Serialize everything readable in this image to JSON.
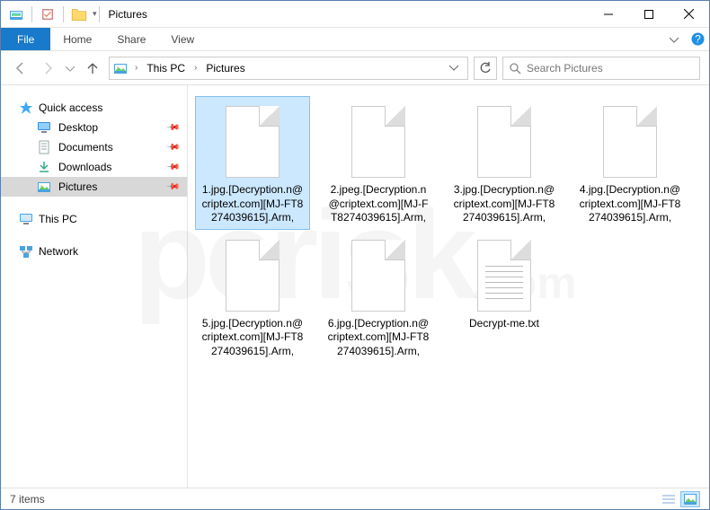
{
  "window": {
    "title": "Pictures"
  },
  "ribbon": {
    "file": "File",
    "tabs": [
      "Home",
      "Share",
      "View"
    ]
  },
  "breadcrumb": {
    "root": "This PC",
    "current": "Pictures"
  },
  "search": {
    "placeholder": "Search Pictures"
  },
  "sidebar": {
    "quick_access": "Quick access",
    "items": [
      {
        "label": "Desktop",
        "icon": "desktop"
      },
      {
        "label": "Documents",
        "icon": "documents"
      },
      {
        "label": "Downloads",
        "icon": "downloads"
      },
      {
        "label": "Pictures",
        "icon": "pictures",
        "selected": true
      }
    ],
    "this_pc": "This PC",
    "network": "Network"
  },
  "files": [
    {
      "name": "1.jpg.[Decryption.n@criptext.com][MJ-FT8274039615].Arm,",
      "type": "blank",
      "selected": true
    },
    {
      "name": "2.jpeg.[Decryption.n@criptext.com][MJ-FT8274039615].Arm,",
      "type": "blank"
    },
    {
      "name": "3.jpg.[Decryption.n@criptext.com][MJ-FT8274039615].Arm,",
      "type": "blank"
    },
    {
      "name": "4.jpg.[Decryption.n@criptext.com][MJ-FT8274039615].Arm,",
      "type": "blank"
    },
    {
      "name": "5.jpg.[Decryption.n@criptext.com][MJ-FT8274039615].Arm,",
      "type": "blank"
    },
    {
      "name": "6.jpg.[Decryption.n@criptext.com][MJ-FT8274039615].Arm,",
      "type": "blank"
    },
    {
      "name": "Decrypt-me.txt",
      "type": "text"
    }
  ],
  "status": {
    "count_label": "7 items"
  }
}
